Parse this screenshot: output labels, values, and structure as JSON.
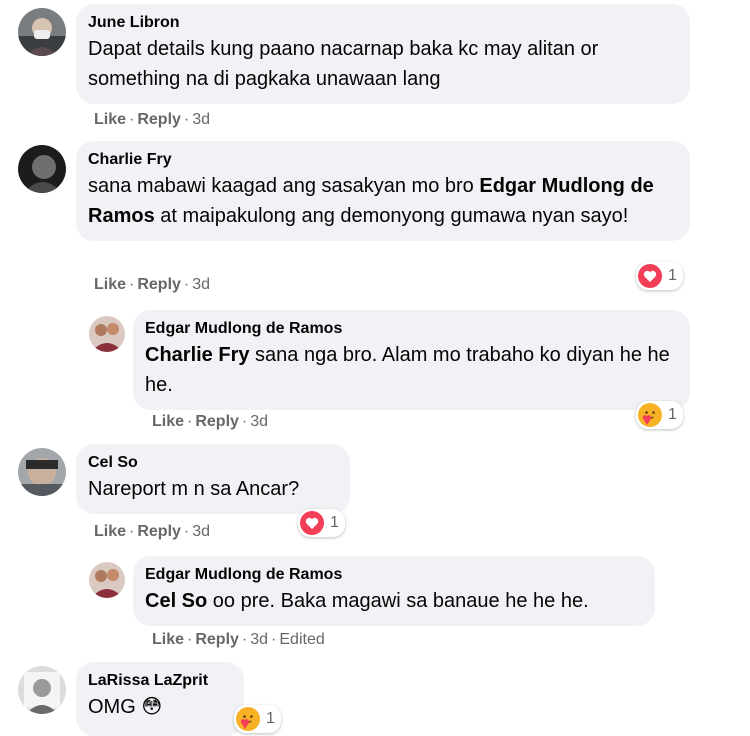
{
  "colors": {
    "bubble": "#f0f2f5",
    "meta_text": "#65676b",
    "love": "#f33e58",
    "care_yellow": "#f7b125"
  },
  "comments": [
    {
      "author": "June Libron",
      "text": "Dapat details kung paano nacarnap baka kc may alitan or something na di pagkaka unawaan lang",
      "like": "Like",
      "reply": "Reply",
      "time": "3d"
    },
    {
      "author": "Charlie Fry",
      "text_before": "sana mabawi kaagad ang sasakyan mo bro ",
      "mention": "Edgar Mudlong de Ramos",
      "text_after": " at maipakulong ang demonyong gumawa nyan sayo!",
      "like": "Like",
      "reply": "Reply",
      "time": "3d",
      "reaction": {
        "icon": "love-icon",
        "count": "1"
      }
    },
    {
      "author": "Edgar Mudlong de Ramos",
      "mention": "Charlie Fry",
      "text_after": " sana nga bro. Alam mo trabaho ko diyan he he he.",
      "like": "Like",
      "reply": "Reply",
      "time": "3d",
      "reaction": {
        "icon": "care-icon",
        "count": "1"
      }
    },
    {
      "author": "Cel So",
      "text": "Nareport m n sa Ancar?",
      "like": "Like",
      "reply": "Reply",
      "time": "3d",
      "reaction": {
        "icon": "love-icon",
        "count": "1"
      }
    },
    {
      "author": "Edgar Mudlong de Ramos",
      "mention": "Cel So",
      "text_after": " oo pre. Baka magawi sa banaue he he he.",
      "like": "Like",
      "reply": "Reply",
      "time": "3d",
      "edited": "Edited"
    },
    {
      "author": "LaRissa LaZprit",
      "text": "OMG 😳",
      "reaction": {
        "icon": "care-icon",
        "count": "1"
      }
    }
  ]
}
